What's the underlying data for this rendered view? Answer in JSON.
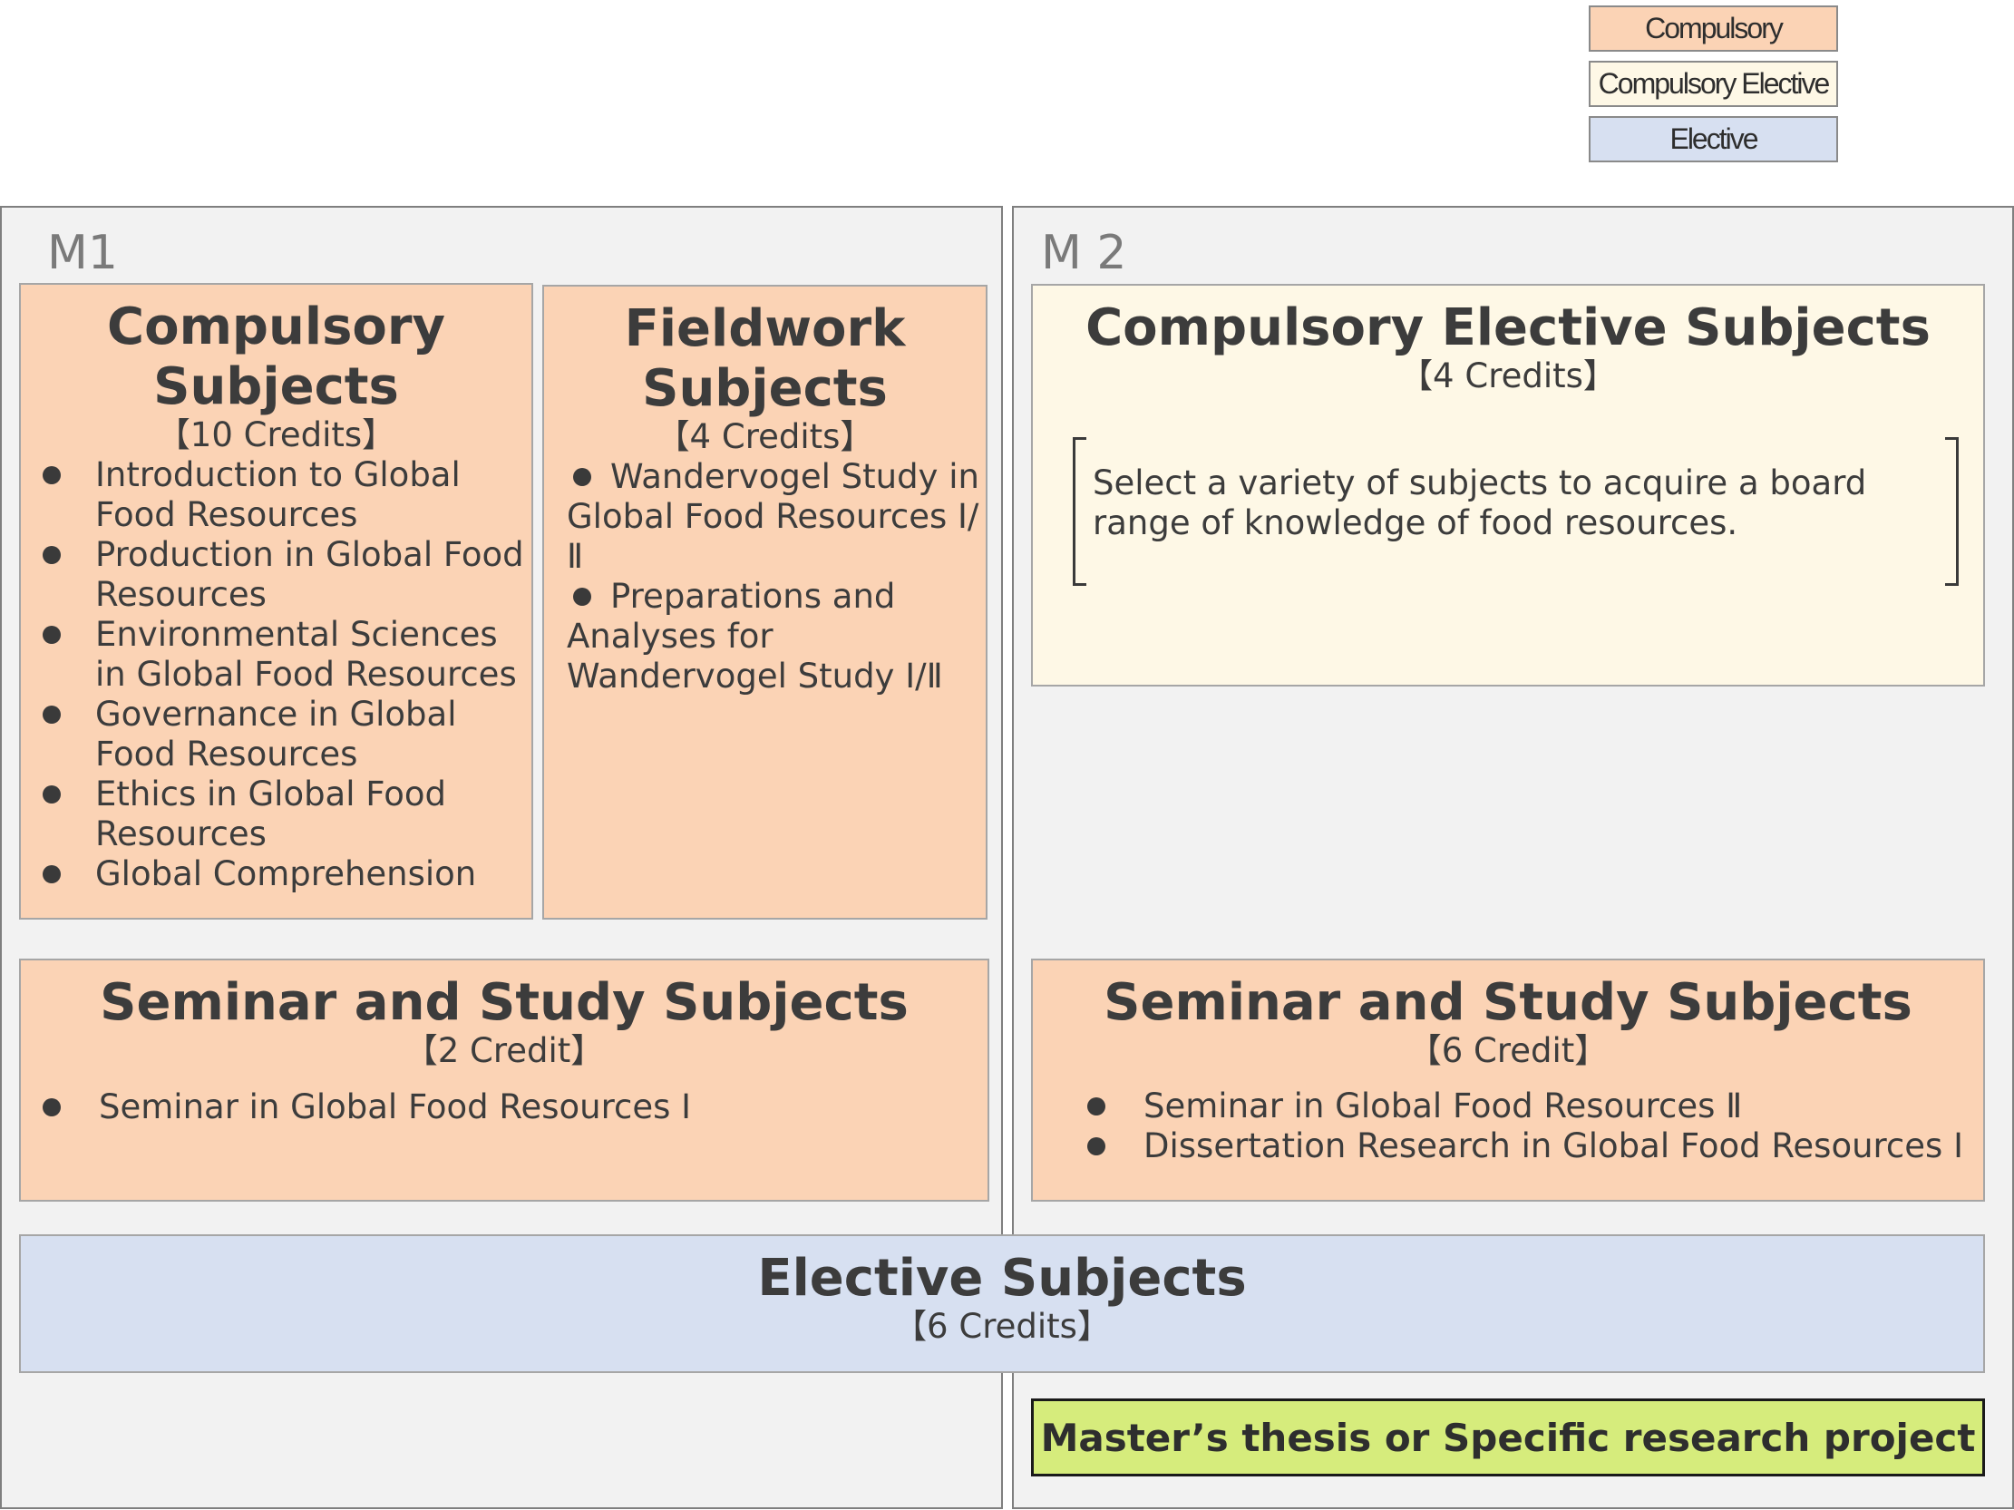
{
  "legend": {
    "compulsory": "Compulsory",
    "compulsory_elective": "Compulsory Elective",
    "elective": "Elective"
  },
  "colors": {
    "compulsory": "#fbd3b5",
    "compulsory_elective": "#fef8e6",
    "elective": "#d7e0f1",
    "thesis": "#d6ec7c",
    "panel": "#f2f2f2"
  },
  "m1": {
    "label": "M1",
    "compulsory": {
      "title_line1": "Compulsory",
      "title_line2": "Subjects",
      "credits": "【10 Credits】",
      "items": [
        "Introduction to Global Food Resources",
        "Production in Global Food Resources",
        "Environmental Sciences in Global Food Resources",
        "Governance in Global Food Resources",
        "Ethics in Global Food Resources",
        "Global Comprehension"
      ]
    },
    "fieldwork": {
      "title_line1": "Fieldwork",
      "title_line2": "Subjects",
      "credits": "【4 Credits】",
      "items": [
        "Wandervogel Study in Global Food Resources Ⅰ/Ⅱ",
        "Preparations and Analyses for Wandervogel Study Ⅰ/Ⅱ"
      ]
    },
    "seminar": {
      "title": "Seminar and Study Subjects",
      "credits": "【2 Credit】",
      "items": [
        "Seminar in Global Food Resources Ⅰ"
      ]
    }
  },
  "m2": {
    "label": "M 2",
    "compulsory_elective": {
      "title": "Compulsory Elective Subjects",
      "credits": "【4 Credits】",
      "note": "Select a variety of subjects to acquire a board range of knowledge of food resources."
    },
    "seminar": {
      "title": "Seminar and Study Subjects",
      "credits": "【6 Credit】",
      "items": [
        "Seminar in Global Food Resources Ⅱ",
        "Dissertation Research in Global Food Resources Ⅰ"
      ]
    }
  },
  "elective": {
    "title": "Elective Subjects",
    "credits": "【6 Credits】"
  },
  "thesis": {
    "label": "Master’s thesis or Specific research project"
  }
}
